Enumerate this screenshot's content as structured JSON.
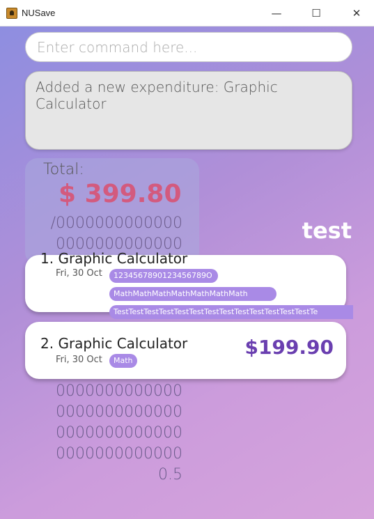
{
  "window": {
    "title": "NUSave",
    "minimize_glyph": "—",
    "maximize_glyph": "☐",
    "close_glyph": "✕"
  },
  "command": {
    "placeholder": "Enter command here..."
  },
  "result": {
    "text": "Added a new expenditure: Graphic Calculator"
  },
  "budget": {
    "total_label": "Total:",
    "total_amount": "$ 399.80",
    "lines": [
      "/0000000000000",
      "0000000000000",
      "0000000000000",
      "0000000000000",
      "0000000000000",
      "0000000000000",
      "0.5"
    ]
  },
  "sheet": {
    "name": "test"
  },
  "expenditures": [
    {
      "name": "1. Graphic Calculator",
      "date": "Fri, 30 Oct",
      "tags": [
        "1234567890123456789O",
        "MathMathMathMathMathMathMath",
        "TestTestTestTestTestTestTestTestTestTestTestTestTestTe"
      ]
    },
    {
      "name": "2. Graphic Calculator",
      "date": "Fri, 30 Oct",
      "tags": [
        "Math"
      ],
      "amount": "$199.90"
    }
  ],
  "colors": {
    "accent": "#6a3fb0",
    "total": "#d35a7e",
    "tag": "#a98ae6"
  }
}
